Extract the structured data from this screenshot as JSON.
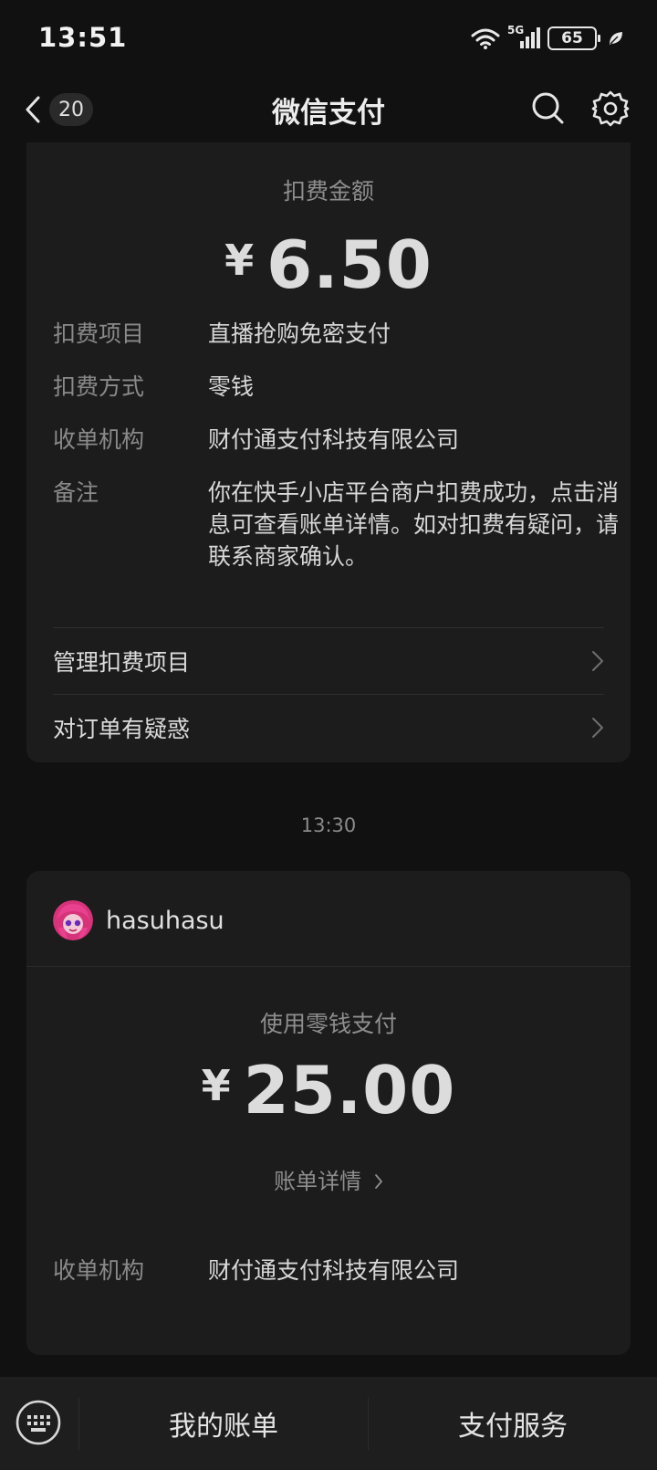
{
  "status_bar": {
    "time": "13:51",
    "network": "5G",
    "battery": "65",
    "icons": [
      "wifi-icon",
      "signal-icon",
      "battery-icon",
      "leaf-icon"
    ]
  },
  "header": {
    "back_count": "20",
    "title": "微信支付",
    "icons": [
      "back-chevron-icon",
      "search-icon",
      "settings-gear-icon"
    ]
  },
  "deduction_card": {
    "amount_label": "扣费金额",
    "currency": "¥",
    "amount": "6.50",
    "details": [
      {
        "key": "扣费项目",
        "value": "直播抢购免密支付"
      },
      {
        "key": "扣费方式",
        "value": "零钱"
      },
      {
        "key": "收单机构",
        "value": "财付通支付科技有限公司"
      },
      {
        "key": "备注",
        "value": "你在快手小店平台商户扣费成功，点击消息可查看账单详情。如对扣费有疑问，请联系商家确认。"
      }
    ],
    "links": [
      {
        "label": "管理扣费项目"
      },
      {
        "label": "对订单有疑惑"
      }
    ]
  },
  "timestamp": "13:30",
  "payment_card": {
    "merchant_name": "hasuhasu",
    "pay_method_label": "使用零钱支付",
    "currency": "¥",
    "amount": "25.00",
    "bill_link": "账单详情",
    "details": [
      {
        "key": "收单机构",
        "value": "财付通支付科技有限公司"
      }
    ]
  },
  "bottom_bar": {
    "my_bills": "我的账单",
    "pay_services": "支付服务"
  },
  "colors": {
    "background": "#111111",
    "card": "#1c1c1c",
    "bottom_bar": "#1e1e1e",
    "primary_text": "#dcdcdc",
    "secondary_text": "#8a8a8a"
  }
}
